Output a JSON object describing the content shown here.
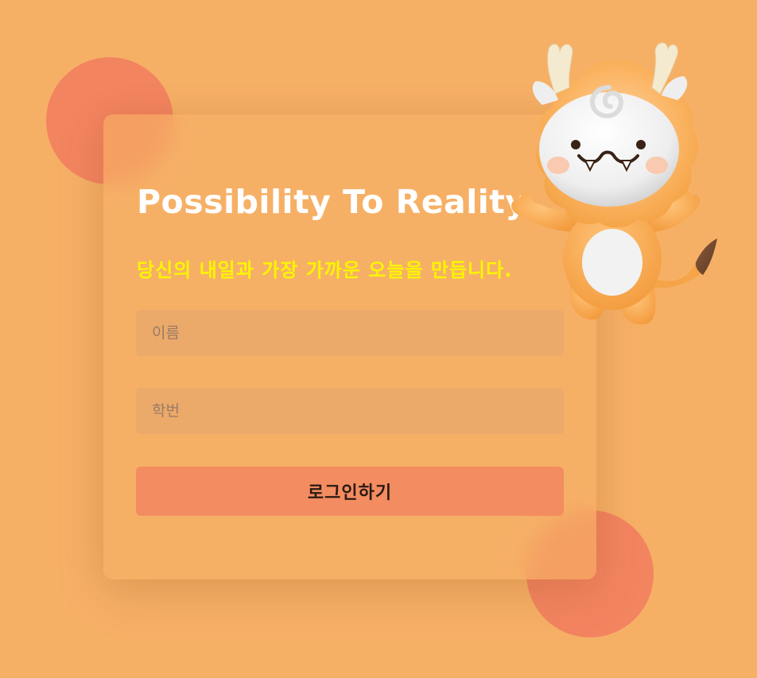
{
  "card": {
    "title": "Possibility To Reality",
    "subtitle": "당신의 내일과 가장 가까운 오늘을 만듭니다."
  },
  "form": {
    "name_placeholder": "이름",
    "id_placeholder": "학번",
    "login_label": "로그인하기"
  },
  "colors": {
    "background": "#f6b066",
    "accent_circle": "#f38460",
    "title": "#ffffff",
    "subtitle": "#fcf500",
    "button": "#f38c60",
    "input": "#ebaa6a"
  },
  "icons": {
    "mascot": "dragon-mascot-icon"
  }
}
